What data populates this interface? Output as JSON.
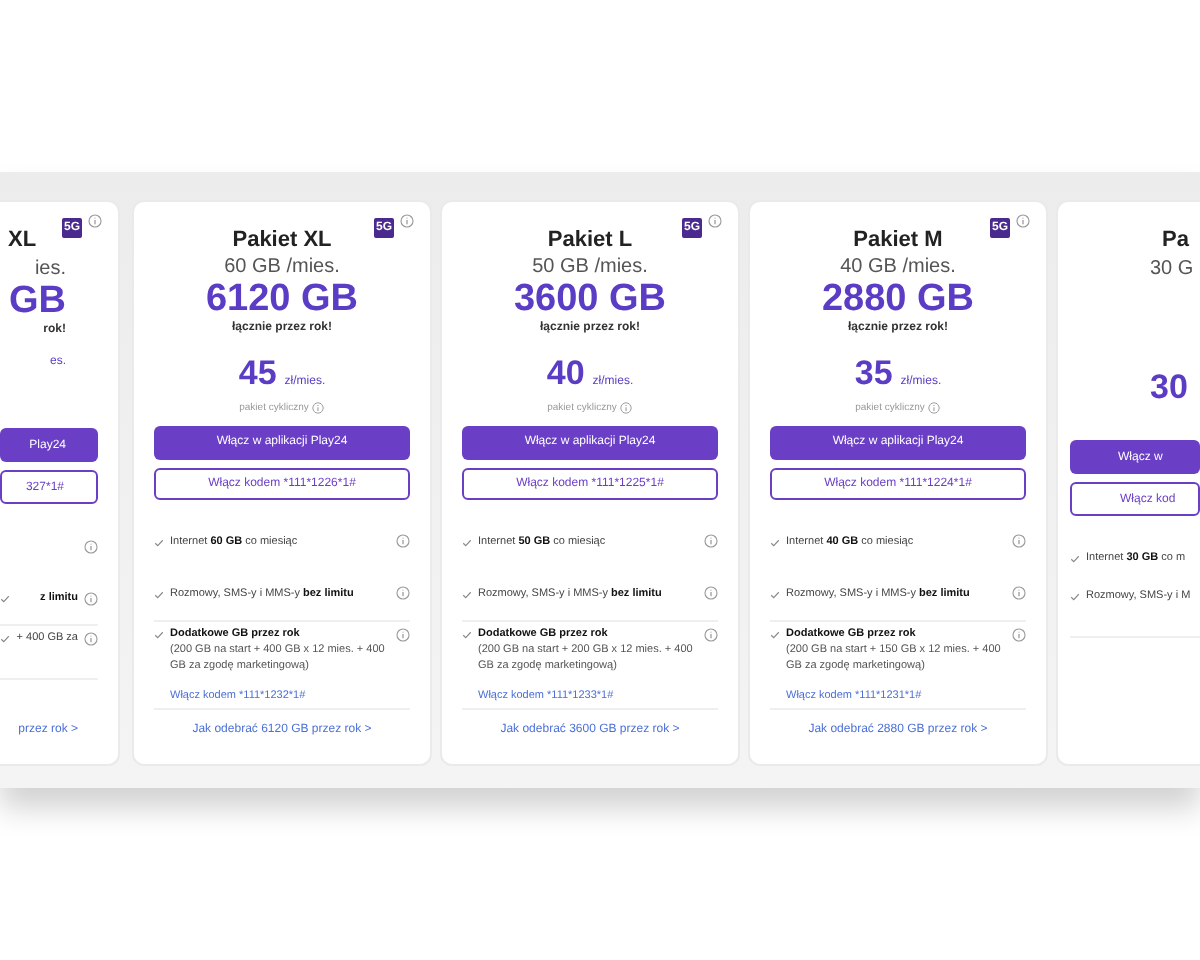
{
  "cards": [
    {
      "kind": "left_partial",
      "title": "XL",
      "badge": "5G",
      "monthly": "ies.",
      "total": "GB",
      "total_note": "rok!",
      "price_unit": "es.",
      "app_button": "Play24",
      "code_button": "327*1#",
      "features": [
        {
          "info": true
        },
        {
          "text": "**z limitu**",
          "info": true
        },
        {
          "text": "+ 400 GB za",
          "info": true
        }
      ],
      "footer_link": "przez rok >"
    },
    {
      "kind": "full",
      "title": "Pakiet XL",
      "badge": "5G",
      "monthly": "60 GB /mies.",
      "total": "6120 GB",
      "total_note": "łącznie przez rok!",
      "price": "45",
      "price_unit": "zł/mies.",
      "price_note": "pakiet cykliczny",
      "app_button": "Włącz w aplikacji Play24",
      "code_button": "Włącz kodem *111*1226*1#",
      "features": [
        {
          "text": "Internet **60 GB** co miesiąc",
          "info": true
        },
        {
          "text": "Rozmowy, SMS-y i MMS-y **bez limitu**",
          "info": true
        },
        {
          "text": "**Dodatkowe GB przez rok**",
          "detail": "(200 GB na start + 400 GB x 12 mies. + 400 GB za zgodę marketingową)",
          "code_link": "Włącz kodem *111*1232*1#",
          "info": true
        }
      ],
      "footer_link": "Jak odebrać 6120 GB przez rok >"
    },
    {
      "kind": "full",
      "title": "Pakiet L",
      "badge": "5G",
      "monthly": "50 GB /mies.",
      "total": "3600 GB",
      "total_note": "łącznie przez rok!",
      "price": "40",
      "price_unit": "zł/mies.",
      "price_note": "pakiet cykliczny",
      "app_button": "Włącz w aplikacji Play24",
      "code_button": "Włącz kodem *111*1225*1#",
      "features": [
        {
          "text": "Internet **50 GB** co miesiąc",
          "info": true
        },
        {
          "text": "Rozmowy, SMS-y i MMS-y **bez limitu**",
          "info": true
        },
        {
          "text": "**Dodatkowe GB przez rok**",
          "detail": "(200 GB na start + 200 GB x 12 mies. + 400 GB za zgodę marketingową)",
          "code_link": "Włącz kodem *111*1233*1#",
          "info": true
        }
      ],
      "footer_link": "Jak odebrać 3600 GB przez rok >"
    },
    {
      "kind": "full",
      "title": "Pakiet M",
      "badge": "5G",
      "monthly": "40 GB /mies.",
      "total": "2880 GB",
      "total_note": "łącznie przez rok!",
      "price": "35",
      "price_unit": "zł/mies.",
      "price_note": "pakiet cykliczny",
      "app_button": "Włącz w aplikacji Play24",
      "code_button": "Włącz kodem *111*1224*1#",
      "features": [
        {
          "text": "Internet **40 GB** co miesiąc",
          "info": true
        },
        {
          "text": "Rozmowy, SMS-y i MMS-y **bez limitu**",
          "info": true
        },
        {
          "text": "**Dodatkowe GB przez rok**",
          "detail": "(200 GB na start + 150 GB x 12 mies. + 400 GB za zgodę marketingową)",
          "code_link": "Włącz kodem *111*1231*1#",
          "info": true
        }
      ],
      "footer_link": "Jak odebrać 2880 GB przez rok >"
    },
    {
      "kind": "right_partial",
      "title": "Pa",
      "monthly": "30 G",
      "price": "30",
      "app_button": "Włącz w",
      "code_button": "Włącz kod",
      "features": [
        {
          "text": "Internet **30 GB** co m",
          "info": false
        },
        {
          "text": "Rozmowy, SMS-y i M",
          "info": false
        }
      ]
    }
  ]
}
